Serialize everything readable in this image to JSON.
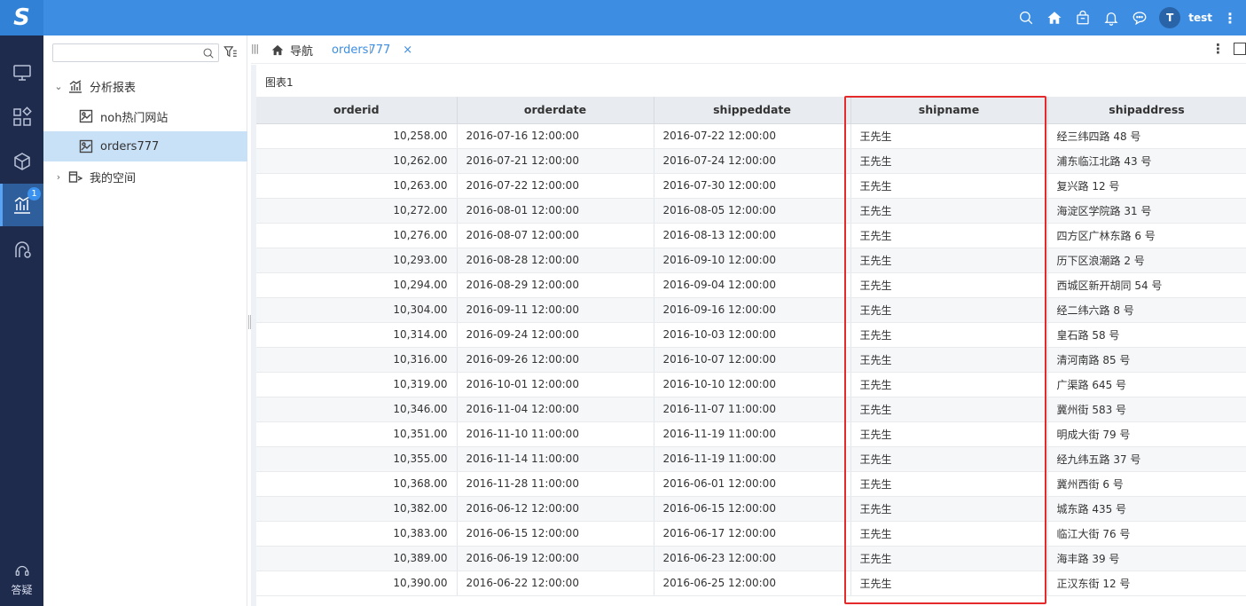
{
  "app": {
    "logo_text": "S",
    "brand_color": "#3d8ee3",
    "highlight_color": "#e42a2a"
  },
  "topbar": {
    "icons": [
      "search-icon",
      "home-icon",
      "bag-icon",
      "bell-icon",
      "chat-icon"
    ],
    "avatar_initial": "T",
    "username": "test",
    "more_icon": "⋮"
  },
  "rail": {
    "items": [
      {
        "name": "monitor-icon"
      },
      {
        "name": "apps-icon"
      },
      {
        "name": "cube-icon"
      },
      {
        "name": "analysis-icon",
        "badge": "1",
        "active": true
      },
      {
        "name": "data-flow-icon"
      }
    ],
    "help_label": "答疑"
  },
  "sidebar": {
    "search": {
      "value": "",
      "placeholder": ""
    },
    "tree": [
      {
        "label": "分析报表",
        "arrow": "⌄",
        "icon": "chart-folder-icon",
        "level": 0
      },
      {
        "label": "noh热门网站",
        "arrow": "",
        "icon": "report-icon",
        "level": 1
      },
      {
        "label": "orders777",
        "arrow": "",
        "icon": "report-icon",
        "level": 1,
        "selected": true
      },
      {
        "label": "我的空间",
        "arrow": "›",
        "icon": "space-icon",
        "level": 0
      }
    ]
  },
  "tabs": {
    "home_label": "导航",
    "active_label": "orders777",
    "close_icon": "×"
  },
  "panel": {
    "title": "图表1",
    "columns": [
      "orderid",
      "orderdate",
      "shippeddate",
      "shipname",
      "shipaddress"
    ],
    "highlighted_column": "shipname",
    "rows": [
      [
        "10,258.00",
        "2016-07-16 12:00:00",
        "2016-07-22 12:00:00",
        "王先生",
        "经三纬四路 48 号"
      ],
      [
        "10,262.00",
        "2016-07-21 12:00:00",
        "2016-07-24 12:00:00",
        "王先生",
        "浦东临江北路 43 号"
      ],
      [
        "10,263.00",
        "2016-07-22 12:00:00",
        "2016-07-30 12:00:00",
        "王先生",
        "复兴路 12 号"
      ],
      [
        "10,272.00",
        "2016-08-01 12:00:00",
        "2016-08-05 12:00:00",
        "王先生",
        "海淀区学院路 31 号"
      ],
      [
        "10,276.00",
        "2016-08-07 12:00:00",
        "2016-08-13 12:00:00",
        "王先生",
        "四方区广林东路 6 号"
      ],
      [
        "10,293.00",
        "2016-08-28 12:00:00",
        "2016-09-10 12:00:00",
        "王先生",
        "历下区浪潮路 2 号"
      ],
      [
        "10,294.00",
        "2016-08-29 12:00:00",
        "2016-09-04 12:00:00",
        "王先生",
        "西城区新开胡同 54 号"
      ],
      [
        "10,304.00",
        "2016-09-11 12:00:00",
        "2016-09-16 12:00:00",
        "王先生",
        "经二纬六路 8 号"
      ],
      [
        "10,314.00",
        "2016-09-24 12:00:00",
        "2016-10-03 12:00:00",
        "王先生",
        "皇石路 58 号"
      ],
      [
        "10,316.00",
        "2016-09-26 12:00:00",
        "2016-10-07 12:00:00",
        "王先生",
        "清河南路  85 号"
      ],
      [
        "10,319.00",
        "2016-10-01 12:00:00",
        "2016-10-10 12:00:00",
        "王先生",
        "广渠路 645 号"
      ],
      [
        "10,346.00",
        "2016-11-04 12:00:00",
        "2016-11-07 11:00:00",
        "王先生",
        "冀州街 583 号"
      ],
      [
        "10,351.00",
        "2016-11-10 11:00:00",
        "2016-11-19 11:00:00",
        "王先生",
        "明成大街 79 号"
      ],
      [
        "10,355.00",
        "2016-11-14 11:00:00",
        "2016-11-19 11:00:00",
        "王先生",
        "经九纬五路 37 号"
      ],
      [
        "10,368.00",
        "2016-11-28 11:00:00",
        "2016-06-01 12:00:00",
        "王先生",
        "冀州西街 6 号"
      ],
      [
        "10,382.00",
        "2016-06-12 12:00:00",
        "2016-06-15 12:00:00",
        "王先生",
        "城东路 435 号"
      ],
      [
        "10,383.00",
        "2016-06-15 12:00:00",
        "2016-06-17 12:00:00",
        "王先生",
        "临江大街 76 号"
      ],
      [
        "10,389.00",
        "2016-06-19 12:00:00",
        "2016-06-23 12:00:00",
        "王先生",
        "海丰路 39 号"
      ],
      [
        "10,390.00",
        "2016-06-22 12:00:00",
        "2016-06-25 12:00:00",
        "王先生",
        "正汉东街 12 号"
      ]
    ]
  }
}
